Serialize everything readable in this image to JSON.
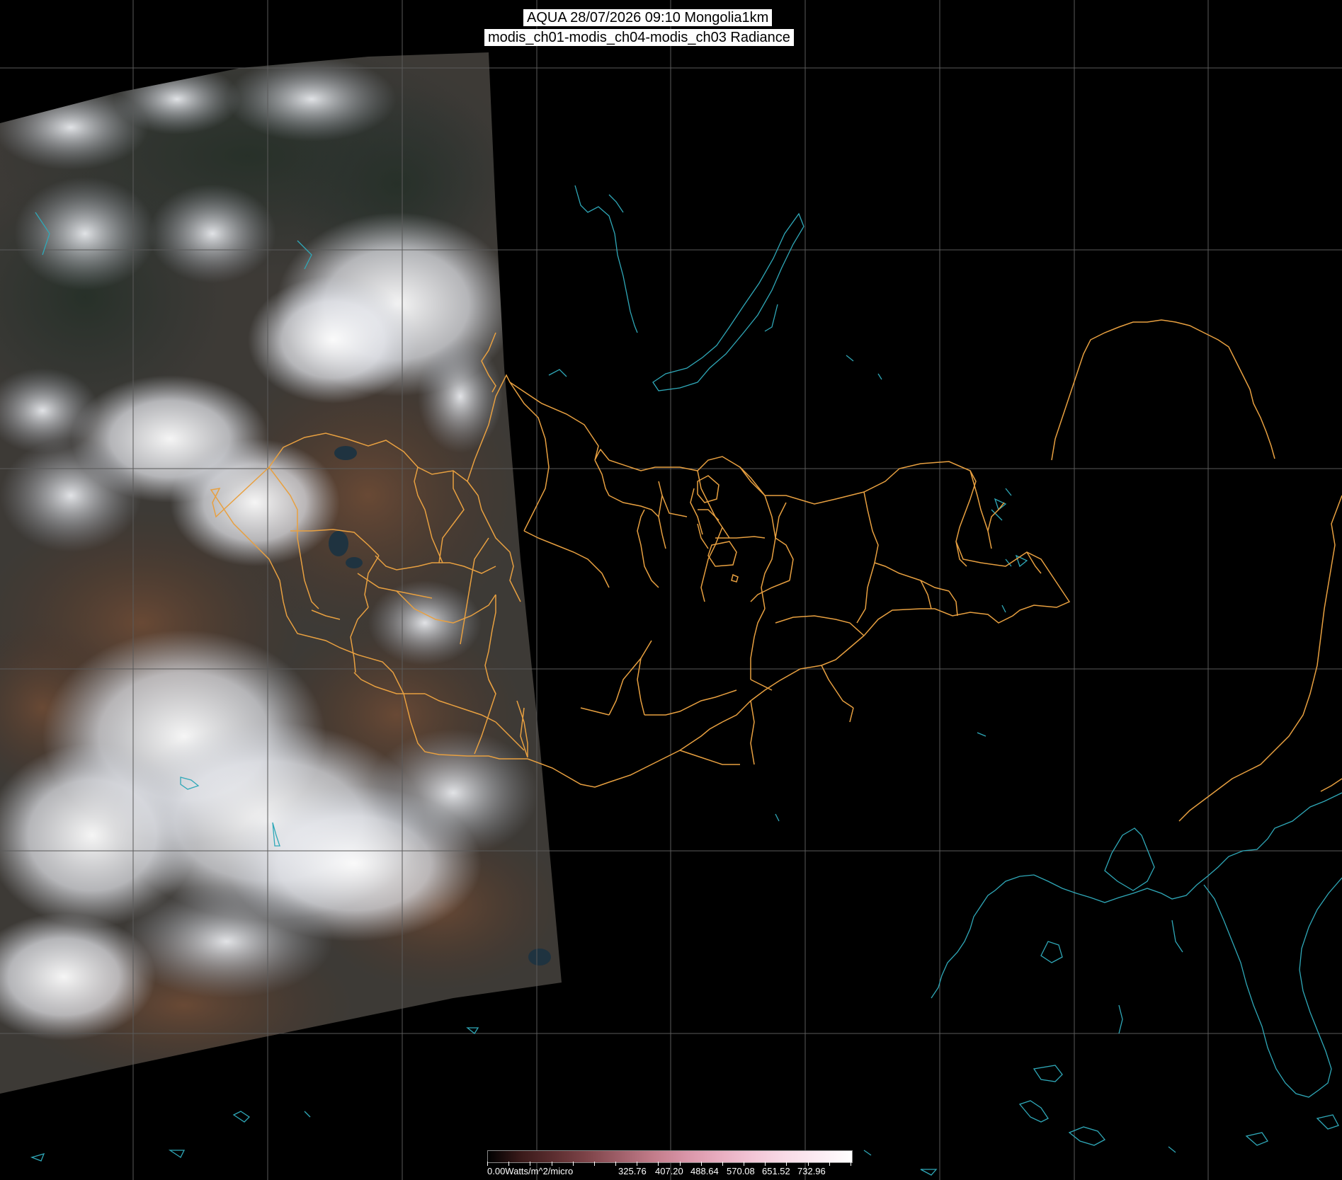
{
  "header": {
    "title_line1": "AQUA 28/07/2026 09:10 Mongolia1km",
    "title_line2": "modis_ch01-modis_ch04-modis_ch03 Radiance"
  },
  "colorbar": {
    "min_label": "0.00Watts/m^2/micro",
    "tick_labels": [
      "325.76",
      "407.20",
      "488.64",
      "570.08",
      "651.52",
      "732.96"
    ],
    "colors": [
      "#000000",
      "#3a1a1a",
      "#5c2e30",
      "#7e4449",
      "#a0606a",
      "#c27c8a",
      "#d995a8",
      "#e8adc0",
      "#f2c5d6",
      "#f8dbe7",
      "#fcecf3",
      "#ffffff"
    ]
  },
  "colors": {
    "border_orange": "#e8a040",
    "coast_cyan": "#2fa8b8",
    "grid_gray": "#5a5a5a",
    "background": "#000000"
  }
}
